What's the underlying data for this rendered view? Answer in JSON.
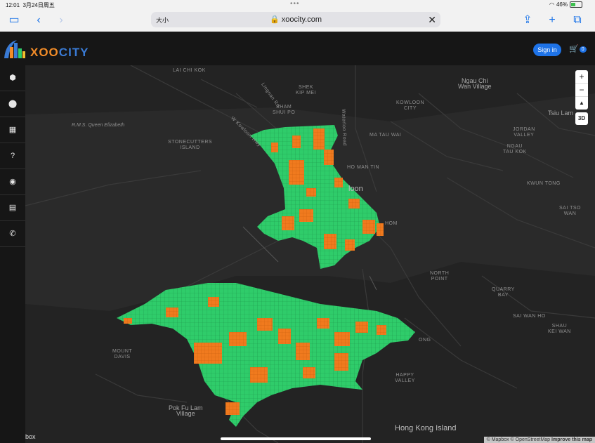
{
  "status_bar": {
    "time": "12:01",
    "date": "3月24日周五",
    "battery": "46%"
  },
  "browser": {
    "text_size_label": "大小",
    "url": "xoocity.com",
    "icons": [
      "sidebar-icon",
      "back-icon",
      "forward-icon",
      "share-icon",
      "plus-icon",
      "tabs-icon"
    ]
  },
  "site": {
    "brand_a": "XOO",
    "brand_b": "CITY",
    "sign_in": "Sign in",
    "cart_count": "0",
    "accent": "#1e73e8"
  },
  "sidenav": {
    "items": [
      "cube-icon",
      "map-pin-icon",
      "cart-icon",
      "help-icon",
      "rss-icon",
      "book-icon",
      "phone-icon"
    ]
  },
  "map": {
    "labels": {
      "lai_chi_kok": "LAI CHI KOK",
      "shek_kip_mei": "SHEK\nKIP MEI",
      "sham_shui_po": "SHAM\nSHUI PO",
      "kowloon_city": "KOWLOON\nCITY",
      "ngau_chi_wan": "Ngau Chi\nWan Village",
      "rms_queen": "R.M.S. Queen Elizabeth",
      "stonecutters": "STONECUTTERS\nISLAND",
      "ma_tau_wai": "MA TAU WAI",
      "jordan_valley": "JORDAN\nVALLEY",
      "ngau_tau_kok": "NGAU\nTAU KOK",
      "ho_man_tin": "HO MAN TIN",
      "kowloon": "loon",
      "kwun_tong": "KWUN TONG",
      "tsiu_lam": "Tsiu Lam",
      "sai_tso_wan": "SAI TSO\nWAN",
      "hom": "HOM",
      "north_point": "NORTH\nPOINT",
      "quarry_bay": "QUARRY\nBAY",
      "sai_wan_ho": "SAI WAN HO",
      "shau_kei_wan": "SHAU\nKEI WAN",
      "mount_davis": "MOUNT\nDAVIS",
      "happy_valley": "HAPPY\nVALLEY",
      "pok_fu_lam": "Pok Fu Lam\nVillage",
      "hong_kong_island": "Hong Kong Island",
      "ong": "ONG",
      "road_waterloo": "Waterloo Road",
      "road_wkowloon": "W Kowloon Hwy",
      "road_lingnan": "Lingnan Rd"
    },
    "controls": {
      "zoom_in": "+",
      "zoom_out": "−",
      "compass": "▲",
      "three_d": "3D"
    },
    "attribution": "© Mapbox © OpenStreetMap",
    "improve": "Improve this map",
    "logo_fragment": "box",
    "colors": {
      "land": "#1f1f1f",
      "water": "#2b2b2b",
      "green": "#2fcc6a",
      "orange": "#f07a1e"
    }
  }
}
